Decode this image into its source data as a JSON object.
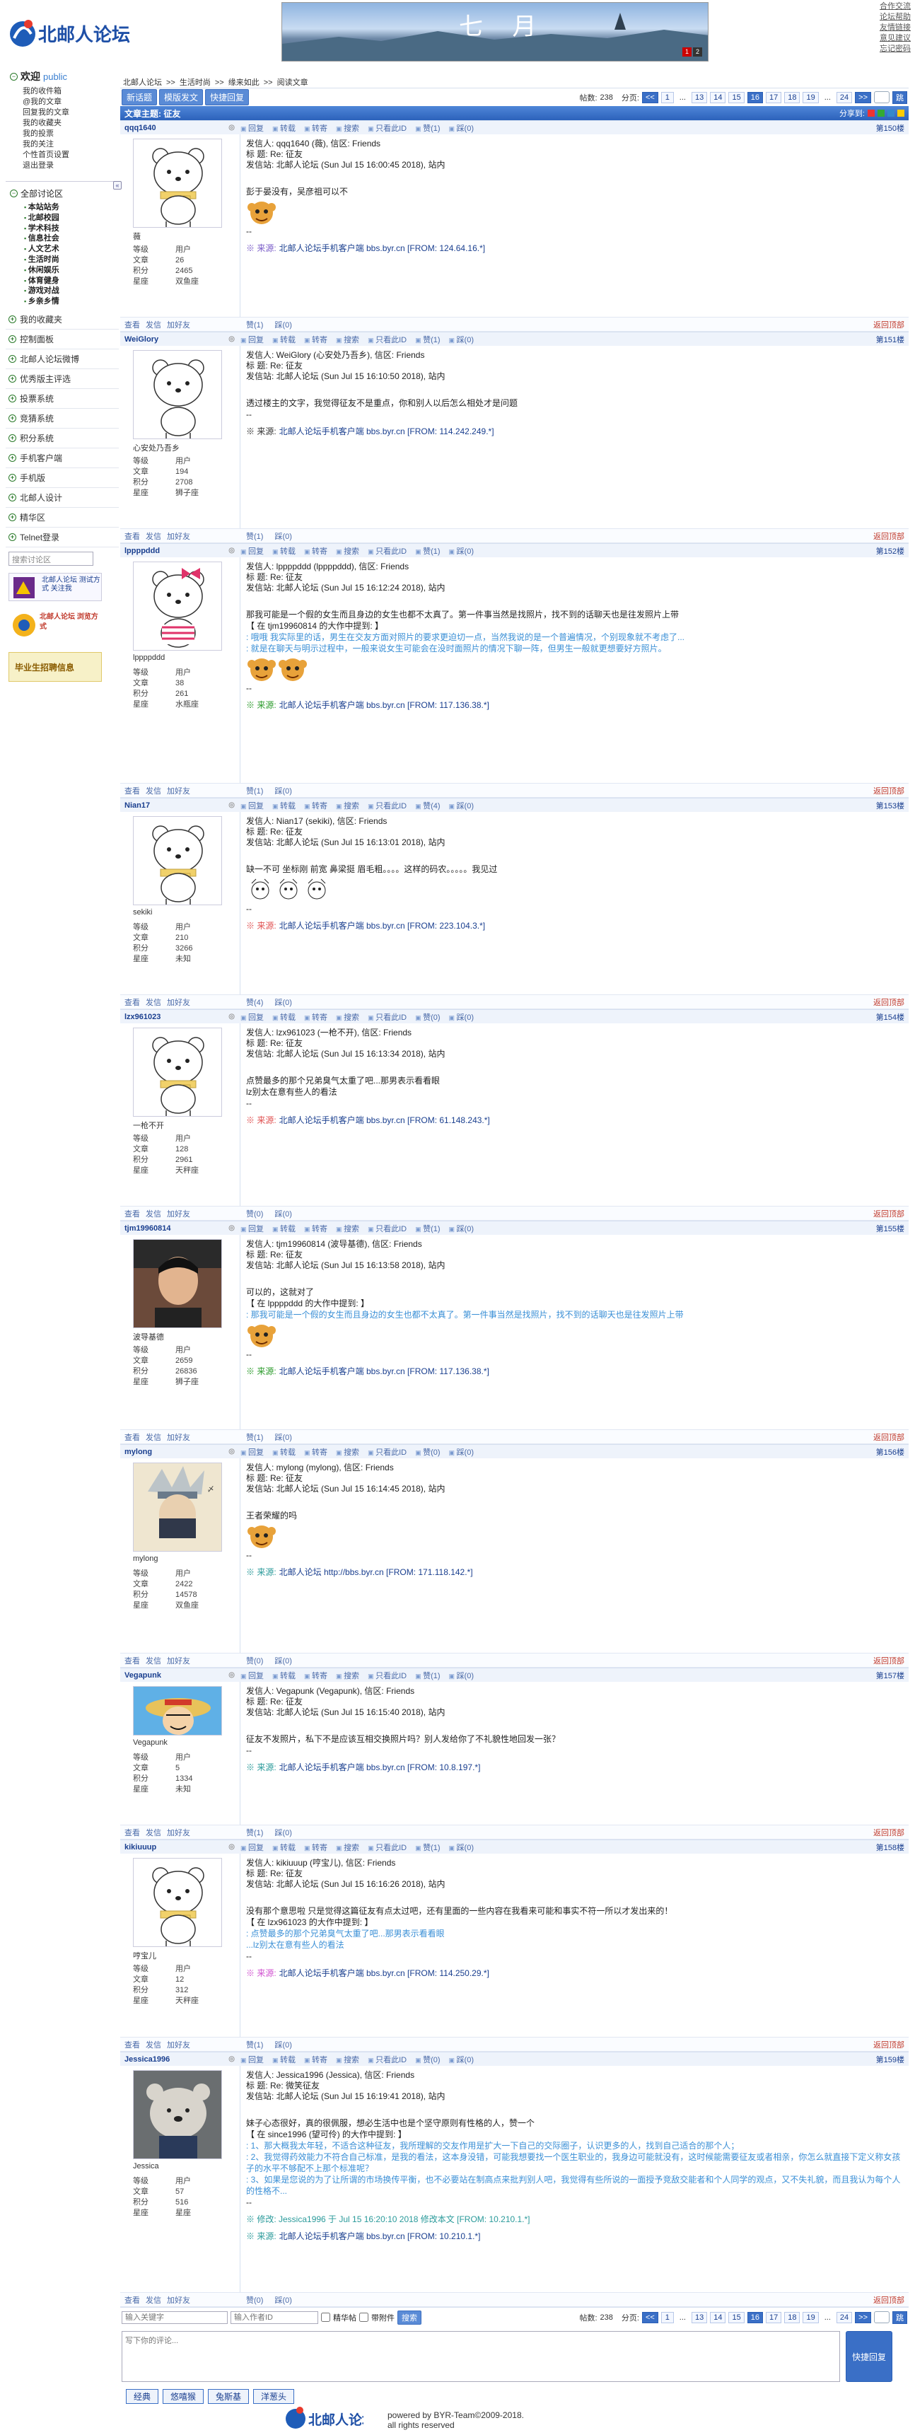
{
  "site": {
    "logo_text": "北邮人论坛",
    "banner_title": "七 月",
    "banner_pages": [
      "1",
      "2"
    ],
    "top_links": [
      "合作交流",
      "论坛帮助",
      "友情链接",
      "意见建议",
      "忘记密码"
    ]
  },
  "sidebar": {
    "welcome": "欢迎",
    "role": "public",
    "user_menu": [
      "我的收件箱",
      "@我的文章",
      "回复我的文章",
      "我的收藏夹",
      "我的投票",
      "我的关注",
      "个性首页设置",
      "退出登录"
    ],
    "all_boards": "全部讨论区",
    "boards": [
      "本站站务",
      "北邮校园",
      "学术科技",
      "信息社会",
      "人文艺术",
      "生活时尚",
      "休闲娱乐",
      "体育健身",
      "游戏对战",
      "乡亲乡情"
    ],
    "fav": "我的收藏夹",
    "control": "控制面板",
    "items": [
      "北邮人论坛微博",
      "优秀版主评选",
      "投票系统",
      "竞猜系统",
      "积分系统",
      "手机客户端",
      "手机版",
      "北邮人设计",
      "精华区",
      "Telnet登录"
    ],
    "search_placeholder": "搜索讨论区",
    "promo1": "北邮人论坛 测试方式 关注我",
    "promo2": "北邮人论坛 浏览方式",
    "promo3": "毕业生招聘信息"
  },
  "main": {
    "crumb": [
      "北邮人论坛",
      ">>",
      "生活时尚",
      ">>",
      "缘来如此",
      ">>",
      "阅读文章"
    ],
    "btn_new": "新话题",
    "btn_mode": "模版发文",
    "btn_quick": "快捷回复",
    "post_count_label": "帖数:",
    "post_count": "238",
    "pages_label": "分页:",
    "pages": [
      "<<",
      "1",
      "...",
      "13",
      "14",
      "15",
      "16",
      "17",
      "18",
      "19",
      "...",
      "24",
      ">>"
    ],
    "current_page": "16",
    "go": "跳",
    "subject": "文章主题: 征友",
    "share": "分享到:"
  },
  "labels": {
    "level": "等级",
    "posts": "文章",
    "score": "积分",
    "star": "星座",
    "reply": "回复",
    "fwd": "转载",
    "tie": "转寄",
    "search": "搜索",
    "only": "只看此ID",
    "like": "赞",
    "dislike": "踩",
    "view": "查看",
    "msg": "发信",
    "friend": "加好友",
    "backtop": "返回顶部",
    "src": "※ 来源:"
  },
  "posts": [
    {
      "uid": "qqq1640",
      "floor": "第150楼",
      "nick": "薇",
      "level": "用户",
      "posts": "26",
      "score": "2465",
      "star": "双鱼座",
      "from": "发信人: qqq1640 (薇), 信区: Friends",
      "title": "标  题: Re: 征友",
      "site": "发信站: 北邮人论坛 (Sun Jul 15 16:00:45 2018), 站内",
      "content": [
        "彭于晏没有，吴彦祖可以不"
      ],
      "quote": [],
      "src": "北邮人论坛手机客户端 bbs.byr.cn [FROM: 124.64.16.*]",
      "like": "赞(1)",
      "dis": "踩(0)",
      "av": "bear-scarf",
      "srccolor": "#7a5cc8"
    },
    {
      "uid": "WeiGlory",
      "floor": "第151楼",
      "nick": "心安处乃吾乡",
      "level": "用户",
      "posts": "194",
      "score": "2708",
      "star": "狮子座",
      "from": "发信人: WeiGlory (心安处乃吾乡), 信区: Friends",
      "title": "标  题: Re: 征友",
      "site": "发信站: 北邮人论坛 (Sun Jul 15 16:10:50 2018), 站内",
      "content": [
        "透过楼主的文字，我觉得征友不是重点，你和别人以后怎么相处才是问题"
      ],
      "quote": [],
      "src": "北邮人论坛手机客户端 bbs.byr.cn [FROM: 114.242.249.*]",
      "like": "赞(1)",
      "dis": "踩(0)",
      "av": "bear-plain",
      "srccolor": "#333"
    },
    {
      "uid": "lppppddd",
      "floor": "第152楼",
      "nick": "lppppddd",
      "level": "用户",
      "posts": "38",
      "score": "261",
      "star": "水瓶座",
      "from": "发信人: lppppddd (lppppddd), 信区: Friends",
      "title": "标  题: Re: 征友",
      "site": "发信站: 北邮人论坛 (Sun Jul 15 16:12:24 2018), 站内",
      "content": [
        "那我可能是一个假的女生而且身边的女生也都不太真了。第一件事当然是找照片，找不到的话聊天也是往发照片上带",
        "【 在 tjm19960814 的大作中提到: 】"
      ],
      "quote": [
        ": 哦哦 我实际里的话，男生在交友方面对照片的要求更迫切一点，当然我说的是一个普遍情况，个别现象就不考虑了...",
        ": 就是在聊天与明示过程中，一般来说女生可能会在没时面照片的情况下聊一阵，但男生一般就更想要好方照片。"
      ],
      "src": "北邮人论坛手机客户端 bbs.byr.cn [FROM: 117.136.38.*]",
      "like": "赞(1)",
      "dis": "踩(0)",
      "av": "bear-bow",
      "srccolor": "#2a9a2a"
    },
    {
      "uid": "Nian17",
      "floor": "第153楼",
      "nick": "sekiki",
      "level": "用户",
      "posts": "210",
      "score": "3266",
      "star": "未知",
      "from": "发信人: Nian17 (sekiki), 信区: Friends",
      "title": "标  题: Re: 征友",
      "site": "发信站: 北邮人论坛 (Sun Jul 15 16:13:01 2018), 站内",
      "content": [
        "缺一不可      坐标刚 前宽 鼻梁挺 眉毛粗。。。。这样的码农。。。。。我见过"
      ],
      "quote": [],
      "src": "北邮人论坛手机客户端 bbs.byr.cn [FROM: 223.104.3.*]",
      "like": "赞(4)",
      "dis": "踩(0)",
      "av": "bear-scarf",
      "srccolor": "#e05050"
    },
    {
      "uid": "lzx961023",
      "floor": "第154楼",
      "nick": "一枪不开",
      "level": "用户",
      "posts": "128",
      "score": "2961",
      "star": "天秤座",
      "from": "发信人: lzx961023 (一枪不开), 信区: Friends",
      "title": "标  题: Re: 征友",
      "site": "发信站: 北邮人论坛 (Sun Jul 15 16:13:34 2018), 站内",
      "content": [
        "点赞最多的那个兄弟臭气太重了吧...那男表示看看眼",
        "lz别太在意有些人的看法"
      ],
      "quote": [],
      "src": "北邮人论坛手机客户端 bbs.byr.cn [FROM: 61.148.243.*]",
      "like": "赞(0)",
      "dis": "踩(0)",
      "av": "bear-scarf",
      "srccolor": "#e05050"
    },
    {
      "uid": "tjm19960814",
      "floor": "第155楼",
      "nick": "波导基德",
      "level": "用户",
      "posts": "2659",
      "score": "26836",
      "star": "狮子座",
      "from": "发信人: tjm19960814 (波导基德), 信区: Friends",
      "title": "标  题: Re: 征友",
      "site": "发信站: 北邮人论坛 (Sun Jul 15 16:13:58 2018), 站内",
      "content": [
        "可以的，这就对了",
        "【 在 lppppddd 的大作中提到: 】"
      ],
      "quote": [
        ": 那我可能是一个假的女生而且身边的女生也都不太真了。第一件事当然是找照片，找不到的话聊天也是往发照片上带"
      ],
      "src": "北邮人论坛手机客户端 bbs.byr.cn [FROM: 117.136.38.*]",
      "like": "赞(1)",
      "dis": "踩(0)",
      "av": "photo",
      "srccolor": "#2a9a2a"
    },
    {
      "uid": "mylong",
      "floor": "第156楼",
      "nick": "mylong",
      "level": "用户",
      "posts": "2422",
      "score": "14578",
      "star": "双鱼座",
      "from": "发信人: mylong (mylong), 信区: Friends",
      "title": "标  题: Re: 征友",
      "site": "发信站: 北邮人论坛 (Sun Jul 15 16:14:45 2018), 站内",
      "content": [
        "王者荣耀的吗"
      ],
      "quote": [],
      "src": "北邮人论坛 http://bbs.byr.cn [FROM: 171.118.142.*]",
      "like": "赞(0)",
      "dis": "踩(0)",
      "av": "ninja",
      "srccolor": "#2a9a9a"
    },
    {
      "uid": "Vegapunk",
      "floor": "第157楼",
      "nick": "Vegapunk",
      "level": "用户",
      "posts": "5",
      "score": "1334",
      "star": "未知",
      "from": "发信人: Vegapunk (Vegapunk), 信区: Friends",
      "title": "标  题: Re: 征友",
      "site": "发信站: 北邮人论坛 (Sun Jul 15 16:15:40 2018), 站内",
      "content": [
        "征友不发照片，私下不是应该互相交换照片吗？别人发给你了不礼貌性地回发一张？"
      ],
      "quote": [],
      "src": "北邮人论坛手机客户端 bbs.byr.cn [FROM: 10.8.197.*]",
      "like": "赞(1)",
      "dis": "踩(0)",
      "av": "luffy",
      "srccolor": "#2a9a9a"
    },
    {
      "uid": "kikiuuup",
      "floor": "第158楼",
      "nick": "哼宝儿",
      "level": "用户",
      "posts": "12",
      "score": "312",
      "star": "天秤座",
      "from": "发信人: kikiuuup (哼宝儿), 信区: Friends",
      "title": "标  题: Re: 征友",
      "site": "发信站: 北邮人论坛 (Sun Jul 15 16:16:26 2018), 站内",
      "content": [
        "没有那个意思啦 只是觉得这篇征友有点太过吧，还有里面的一些内容在我看来可能和事实不符一所以才发出来的！",
        "【 在 lzx961023 的大作中提到: 】"
      ],
      "quote": [
        ": 点赞最多的那个兄弟臭气太重了吧...那男表示看看眼",
        "...lz别太在意有些人的看法"
      ],
      "src": "北邮人论坛手机客户端 bbs.byr.cn [FROM: 114.250.29.*]",
      "like": "赞(1)",
      "dis": "踩(0)",
      "av": "bear-scarf",
      "srccolor": "#d050d0"
    },
    {
      "uid": "Jessica1996",
      "floor": "第159楼",
      "nick": "Jessica",
      "level": "用户",
      "posts": "57",
      "score": "516",
      "star": "星座",
      "from": "发信人: Jessica1996 (Jessica), 信区: Friends",
      "title": "标  题: Re: 微笑征友",
      "site": "发信站: 北邮人论坛 (Sun Jul 15 16:19:41 2018), 站内",
      "content": [
        "妹子心态很好，真的很佩服，想必生活中也是个坚守原则有性格的人，赞一个",
        "【 在 since1996 (望可伶) 的大作中提到: 】"
      ],
      "quote": [
        ": 1、那大概我太年轻，不适合这种征友，我所理解的交友作用是扩大一下自己的交际圈子，认识更多的人，找到自己适合的那个人；",
        ": 2、我觉得药效能力不符合自己标准，是我的看法，这本身没错，可能我想要找一个医生职业的，我身边可能就没有，这时候能需要征友或者相亲，你怎么就直接下定义称女孩子的水平不够配不上那个标准呢？",
        ": 3、如果是您说的为了让所谓的市场换传平衡，也不必要站在制高点来批判别人吧，我觉得有些所说的一面授予竞敌交能者和个人同学的观点，又不失礼貌，而且我认为每个人的性格不..."
      ],
      "src": "北邮人论坛手机客户端 bbs.byr.cn [FROM: 10.210.1.*]",
      "edit": "※ 修改: Jessica1996 于 Jul 15 16:20:10 2018 修改本文 [FROM: 10.210.1.*]",
      "like": "赞(0)",
      "dis": "踩(0)",
      "av": "bear-photo",
      "srccolor": "#2a9a9a"
    }
  ],
  "bottom": {
    "kw_placeholder": "输入关键字",
    "author_placeholder": "输入作者ID",
    "chk1": "精华帖",
    "chk2": "带附件",
    "search_btn": "搜索",
    "reply_placeholder": "写下你的评论...",
    "send": "快捷回复",
    "emo_tabs": [
      "经典",
      "悠嘻猴",
      "兔斯基",
      "洋葱头"
    ]
  },
  "footer": {
    "line1": "powered by BYR-Team©2009-2018.",
    "line2": "all rights reserved"
  }
}
